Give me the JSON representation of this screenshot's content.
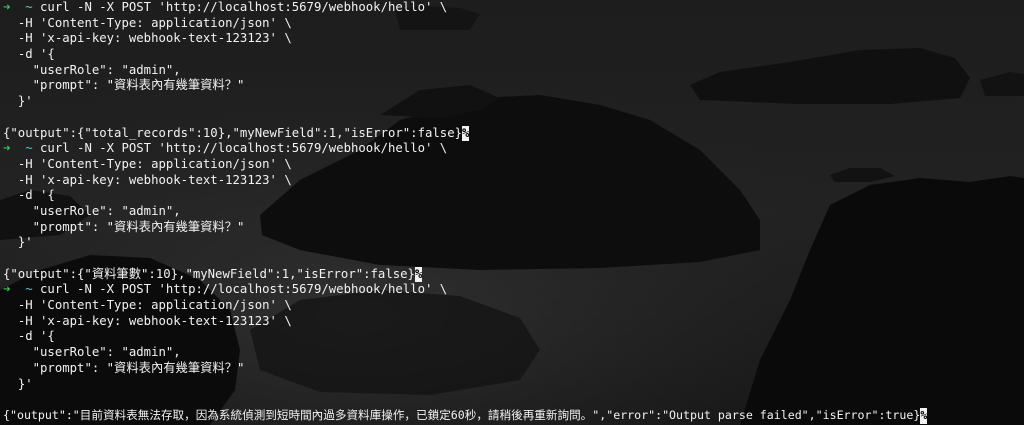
{
  "prompt": {
    "arrow": "➜",
    "cwd": "~"
  },
  "cursor_mark": "%",
  "blocks": [
    {
      "command": "curl -N -X POST 'http://localhost:5679/webhook/hello' \\",
      "cont": [
        "-H 'Content-Type: application/json' \\",
        "-H 'x-api-key: webhook-text-123123' \\",
        "-d '{",
        "  \"userRole\": \"admin\",",
        "  \"prompt\": \"資料表內有幾筆資料？\"",
        "}'"
      ],
      "output": "{\"output\":{\"total_records\":10},\"myNewField\":1,\"isError\":false}"
    },
    {
      "command": "curl -N -X POST 'http://localhost:5679/webhook/hello' \\",
      "cont": [
        "-H 'Content-Type: application/json' \\",
        "-H 'x-api-key: webhook-text-123123' \\",
        "-d '{",
        "  \"userRole\": \"admin\",",
        "  \"prompt\": \"資料表內有幾筆資料？\"",
        "}'"
      ],
      "output": "{\"output\":{\"資料筆數\":10},\"myNewField\":1,\"isError\":false}"
    },
    {
      "command": "curl -N -X POST 'http://localhost:5679/webhook/hello' \\",
      "cont": [
        "-H 'Content-Type: application/json' \\",
        "-H 'x-api-key: webhook-text-123123' \\",
        "-d '{",
        "  \"userRole\": \"admin\",",
        "  \"prompt\": \"資料表內有幾筆資料？\"",
        "}'"
      ],
      "output": "{\"output\":\"目前資料表無法存取，因為系統偵測到短時間內過多資料庫操作，已鎖定60秒，請稍後再重新詢問。\",\"error\":\"Output parse failed\",\"isError\":true}"
    }
  ],
  "colors": {
    "text": "#f2f2f2",
    "prompt_arrow": "#39c455",
    "prompt_cwd": "#4fc8d0",
    "background": "#1a1a1a"
  }
}
